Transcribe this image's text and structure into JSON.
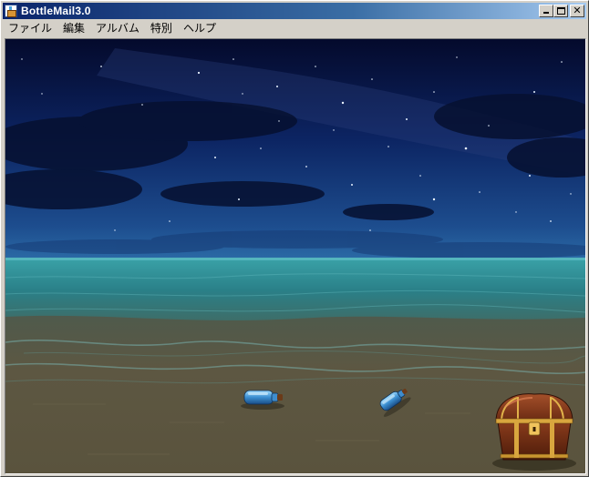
{
  "window": {
    "title": "BottleMail3.0",
    "minimize_glyph": "",
    "maximize_glyph": "",
    "close_glyph": "✕"
  },
  "menu": {
    "items": [
      "ファイル",
      "編集",
      "アルバム",
      "特別",
      "ヘルプ"
    ]
  },
  "scene": {
    "description_icons": [
      "bottle-icon",
      "bottle-icon",
      "treasure-chest-icon"
    ],
    "colors": {
      "sky_top": "#050d33",
      "sky_horizon": "#1c4f8c",
      "sea": "#2f8a94",
      "sand": "#5b543f"
    }
  }
}
